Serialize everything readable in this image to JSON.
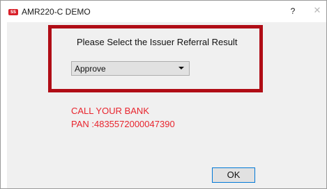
{
  "window": {
    "title": "AMR220-C DEMO",
    "help_label": "?",
    "close_label": "✕"
  },
  "dialog": {
    "prompt": "Please Select the Issuer Referral Result",
    "select": {
      "selected": "Approve"
    },
    "messages": {
      "line1": "CALL YOUR BANK",
      "line2": "PAN :4835572000047390"
    },
    "ok_label": "OK"
  },
  "colors": {
    "highlight_border": "#b00d16",
    "message_text": "#e8242d",
    "client_bg": "#f0f0f0",
    "button_focus_border": "#0078d7"
  }
}
